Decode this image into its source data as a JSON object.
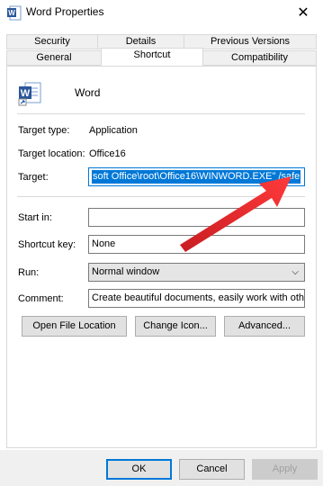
{
  "window": {
    "title": "Word Properties",
    "close_glyph": "✕"
  },
  "tabs_row1": [
    "Security",
    "Details",
    "Previous Versions"
  ],
  "tabs_row2": [
    "General",
    "Shortcut",
    "Compatibility"
  ],
  "active_tab": "Shortcut",
  "app": {
    "name": "Word",
    "icon_letter": "W",
    "brand_color": "#2b579a"
  },
  "fields": {
    "target_type_label": "Target type:",
    "target_type_value": "Application",
    "target_location_label": "Target location:",
    "target_location_value": "Office16",
    "target_label": "Target:",
    "target_value": "soft Office\\root\\Office16\\WINWORD.EXE\" /safe",
    "start_in_label": "Start in:",
    "start_in_value": "",
    "shortcut_key_label": "Shortcut key:",
    "shortcut_key_value": "None",
    "run_label": "Run:",
    "run_value": "Normal window",
    "comment_label": "Comment:",
    "comment_value": "Create beautiful documents, easily work with other"
  },
  "buttons": {
    "open_file_location": "Open File Location",
    "change_icon": "Change Icon...",
    "advanced": "Advanced...",
    "ok": "OK",
    "cancel": "Cancel",
    "apply": "Apply"
  },
  "colors": {
    "selection": "#0078d7",
    "arrow": "#e8262a"
  }
}
